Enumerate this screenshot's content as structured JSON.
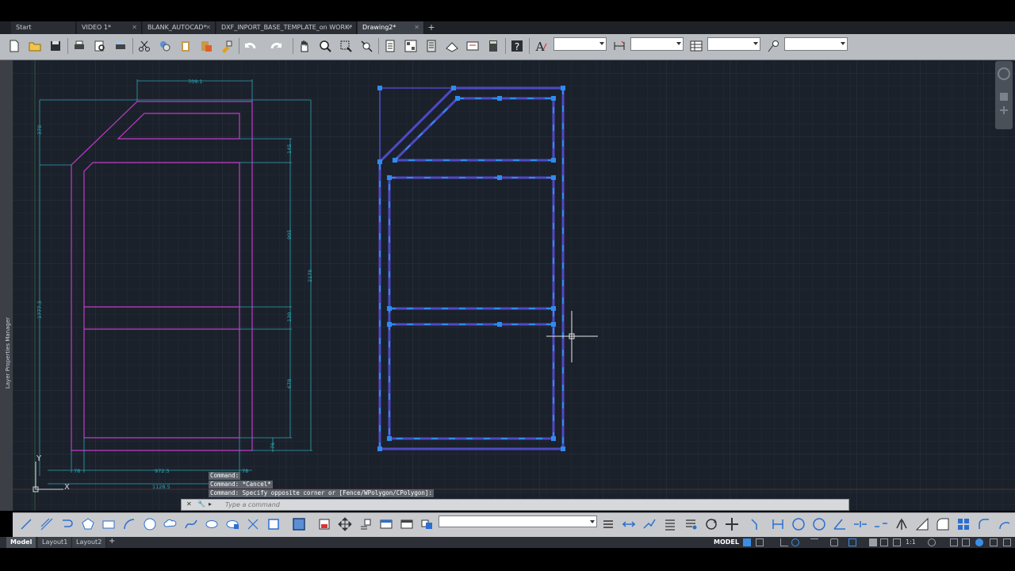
{
  "tabs": [
    {
      "label": "Start",
      "active": false
    },
    {
      "label": "VIDEO 1*",
      "active": false
    },
    {
      "label": "BLANK_AUTOCAD*",
      "active": false
    },
    {
      "label": "DXF_INPORT_BASE_TEMPLATE_on WORK*",
      "active": false
    },
    {
      "label": "Drawing2*",
      "active": true
    }
  ],
  "new_tab": "+",
  "side_panel": {
    "label": "Layer Properties Manager"
  },
  "drawing": {
    "dimensions": [
      "709.1",
      "378",
      "145",
      "905",
      "2176",
      "1777.3",
      "130",
      "678",
      "76",
      "78",
      "972.5",
      "78",
      "1128.5"
    ],
    "ucs": {
      "y": "Y",
      "x": "X"
    }
  },
  "command": {
    "history": [
      "Command:",
      "Command: *Cancel*",
      "Command: Specify opposite corner or [Fence/WPolygon/CPolygon]:"
    ],
    "placeholder": "Type a command"
  },
  "layouts": [
    {
      "label": "Model",
      "active": true
    },
    {
      "label": "Layout1",
      "active": false
    },
    {
      "label": "Layout2",
      "active": false
    }
  ],
  "add_layout": "+",
  "status": {
    "model": "MODEL",
    "scale": "1:1"
  },
  "colors": {
    "canvas": "#1b212b",
    "magenta": "#c03cc8",
    "cyan": "#2aa6b4",
    "selection": "#4d4ac4",
    "grip": "#2f8bf0"
  }
}
